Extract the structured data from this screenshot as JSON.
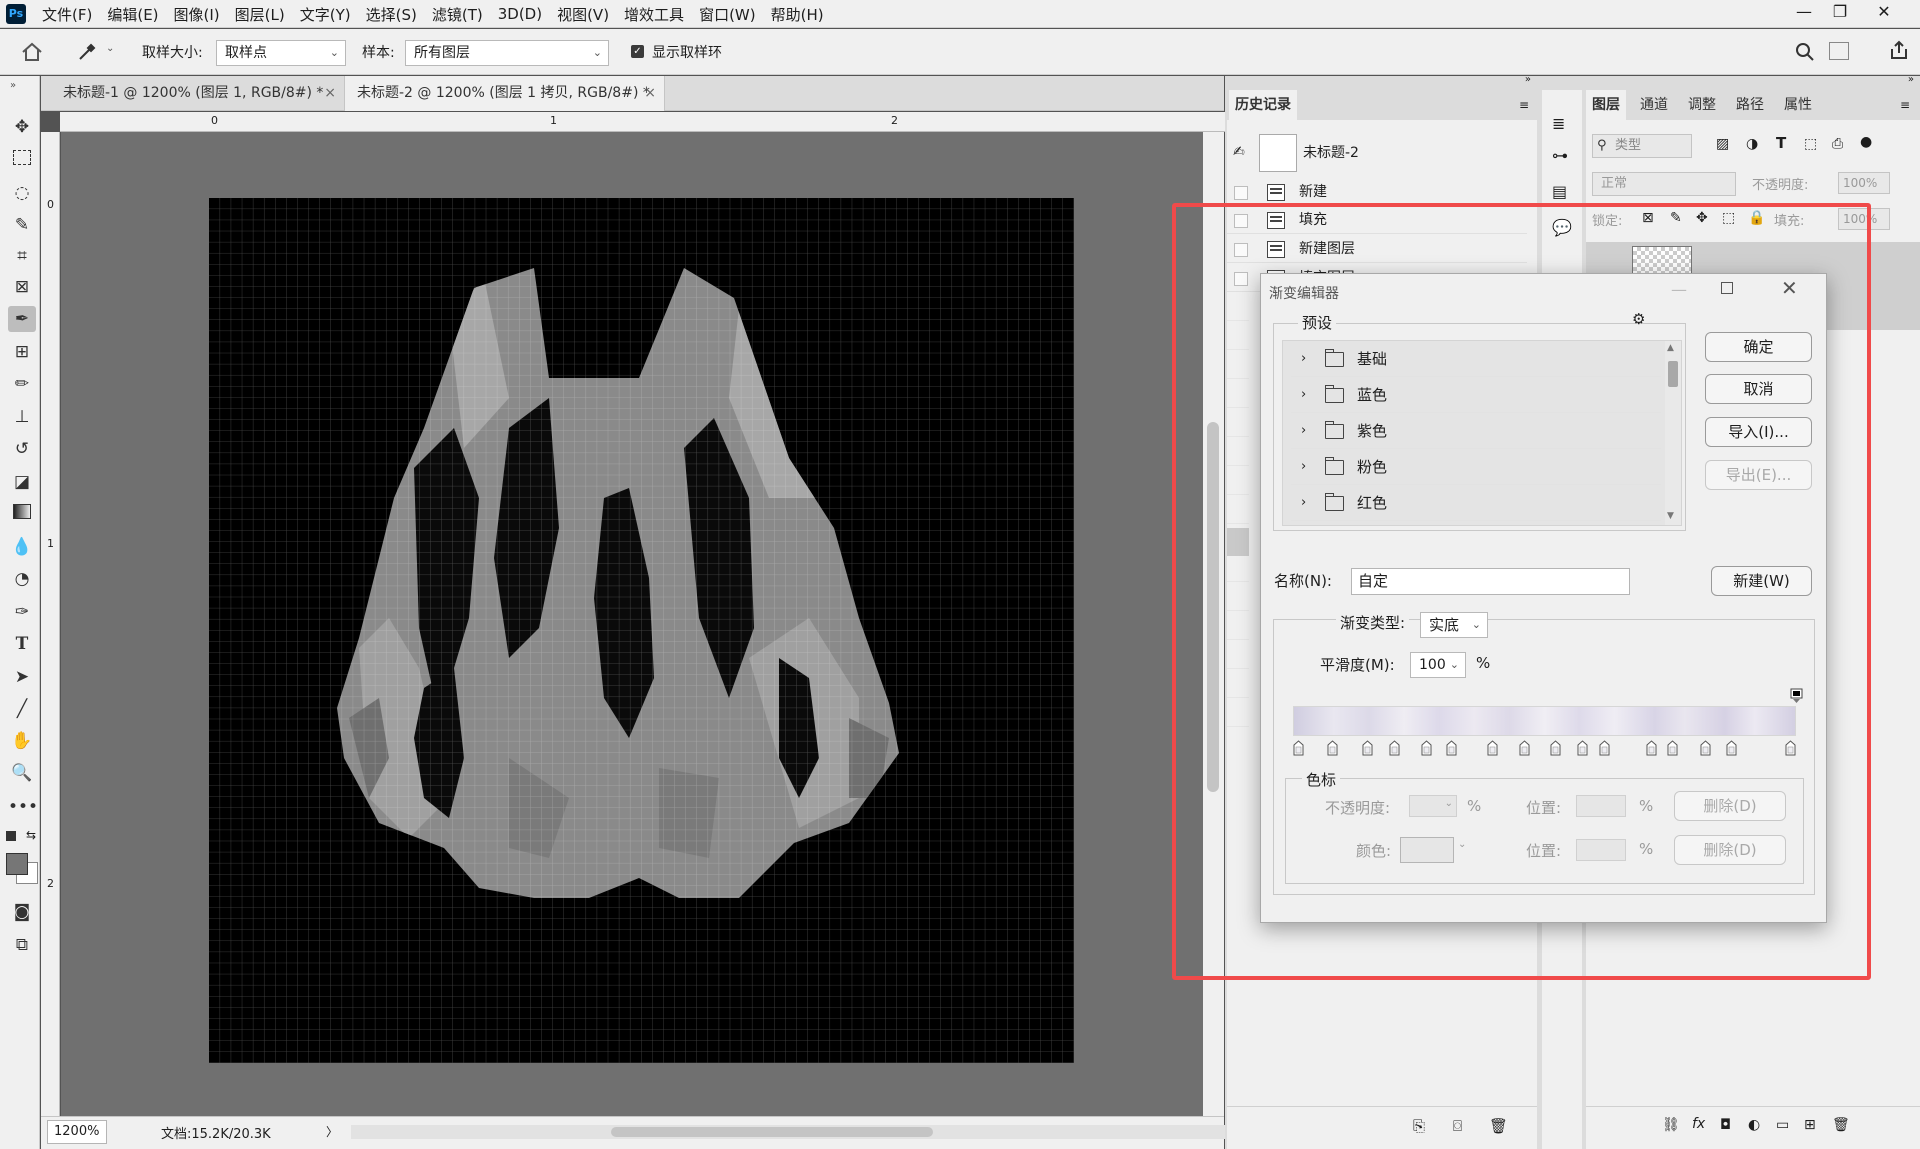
{
  "app": {
    "logo": "Ps"
  },
  "menu": [
    "文件(F)",
    "编辑(E)",
    "图像(I)",
    "图层(L)",
    "文字(Y)",
    "选择(S)",
    "滤镜(T)",
    "3D(D)",
    "视图(V)",
    "增效工具",
    "窗口(W)",
    "帮助(H)"
  ],
  "options": {
    "sample_size_label": "取样大小:",
    "sample_size_value": "取样点",
    "sample_label": "样本:",
    "sample_value": "所有图层",
    "show_ring_label": "显示取样环"
  },
  "tabs": [
    {
      "label": "未标题-1 @ 1200% (图层 1, RGB/8#) *",
      "close": "×"
    },
    {
      "label": "未标题-2 @ 1200% (图层 1 拷贝, RGB/8#) *",
      "close": "×"
    }
  ],
  "ruler": {
    "h": [
      "0",
      "1",
      "2"
    ],
    "v": [
      "0",
      "1",
      "2"
    ]
  },
  "status": {
    "zoom": "1200%",
    "doc": "文档:15.2K/20.3K",
    "arrow": "〉"
  },
  "history": {
    "tab": "历史记录",
    "snapshot": "未标题-2",
    "items": [
      "新建",
      "填充",
      "新建图层",
      "填充图层"
    ]
  },
  "layers": {
    "tabs": [
      "图层",
      "通道",
      "调整",
      "路径",
      "属性"
    ],
    "filter_placeholder": "类型",
    "blend": "正常",
    "opacity_label": "不透明度:",
    "opacity": "100%",
    "lock_label": "锁定:",
    "fill_label": "填充:",
    "fill": "100%"
  },
  "dialog": {
    "title": "渐变编辑器",
    "presets_label": "预设",
    "presets": [
      "基础",
      "蓝色",
      "紫色",
      "粉色",
      "红色"
    ],
    "ok": "确定",
    "cancel": "取消",
    "import": "导入(I)...",
    "export": "导出(E)...",
    "name_label": "名称(N):",
    "name_value": "自定",
    "new": "新建(W)",
    "type_label": "渐变类型:",
    "type_value": "实底",
    "smooth_label": "平滑度(M):",
    "smooth_value": "100",
    "pct": "%",
    "stops_label": "色标",
    "opacity_label": "不透明度:",
    "position_label": "位置:",
    "delete_label": "删除(D)",
    "color_label": "颜色:"
  },
  "gradient_stops": [
    0,
    0.07,
    0.14,
    0.196,
    0.26,
    0.31,
    0.395,
    0.46,
    0.523,
    0.578,
    0.622,
    0.717,
    0.76,
    0.828,
    0.88,
    1.0
  ],
  "colors": {
    "highlight": "#f04a4a",
    "accent": "#31a8ff"
  }
}
